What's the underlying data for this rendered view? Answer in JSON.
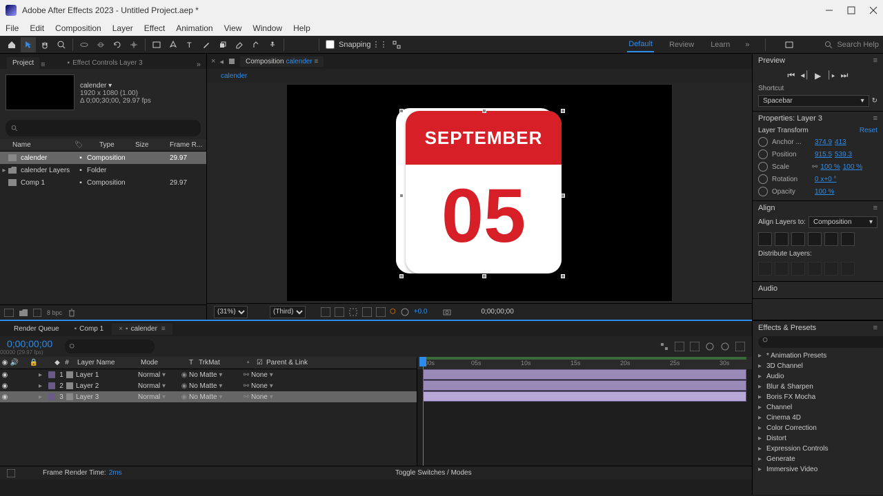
{
  "titlebar": {
    "title": "Adobe After Effects 2023 - Untitled Project.aep *"
  },
  "menu": [
    "File",
    "Edit",
    "Composition",
    "Layer",
    "Effect",
    "Animation",
    "View",
    "Window",
    "Help"
  ],
  "toolbar": {
    "snapping": "Snapping",
    "workspaces": [
      "Default",
      "Review",
      "Learn"
    ],
    "search_placeholder": "Search Help"
  },
  "project": {
    "tab_project": "Project",
    "tab_effect_controls": "Effect Controls Layer 3",
    "comp_name": "calender ▾",
    "comp_dims": "1920 x 1080 (1.00)",
    "comp_duration": "Δ 0;00;30;00, 29.97 fps",
    "col_name": "Name",
    "col_type": "Type",
    "col_size": "Size",
    "col_framerate": "Frame R...",
    "rows": [
      {
        "name": "calender",
        "type": "Composition",
        "fr": "29.97",
        "sel": true,
        "icon": "comp"
      },
      {
        "name": "calender Layers",
        "type": "Folder",
        "fr": "",
        "sel": false,
        "icon": "folder"
      },
      {
        "name": "Comp 1",
        "type": "Composition",
        "fr": "29.97",
        "sel": false,
        "icon": "comp"
      }
    ]
  },
  "comp": {
    "tab_label": "Composition",
    "tab_link": "calender",
    "breadcrumb": "calender",
    "month": "SEPTEMBER",
    "day": "05",
    "zoom": "(31%)",
    "res": "(Third)",
    "exposure": "+0.0",
    "timecode": "0;00;00;00"
  },
  "preview": {
    "header": "Preview",
    "shortcut_label": "Shortcut",
    "shortcut_value": "Spacebar"
  },
  "properties": {
    "header": "Properties: Layer 3",
    "transform_label": "Layer Transform",
    "reset": "Reset",
    "anchor_label": "Anchor ...",
    "anchor_x": "374.9",
    "anchor_y": "413",
    "position_label": "Position",
    "position_x": "915.5",
    "position_y": "539.3",
    "scale_label": "Scale",
    "scale_x": "100 %",
    "scale_y": "100 %",
    "rotation_label": "Rotation",
    "rotation_v": "0 x+0 °",
    "opacity_label": "Opacity",
    "opacity_v": "100 %"
  },
  "align": {
    "header": "Align",
    "layers_to_label": "Align Layers to:",
    "layers_to_value": "Composition",
    "distribute": "Distribute Layers:"
  },
  "audio": {
    "header": "Audio"
  },
  "effects": {
    "header": "Effects & Presets",
    "items": [
      "* Animation Presets",
      "3D Channel",
      "Audio",
      "Blur & Sharpen",
      "Boris FX Mocha",
      "Channel",
      "Cinema 4D",
      "Color Correction",
      "Distort",
      "Expression Controls",
      "Generate",
      "Immersive Video"
    ]
  },
  "timeline": {
    "tab_render": "Render Queue",
    "tab_comp1": "Comp 1",
    "tab_calender": "calender",
    "timecode": "0;00;00;00",
    "timecode_sub": "00000 (29.97 fps)",
    "col_layername": "Layer Name",
    "col_mode": "Mode",
    "col_trkmat": "TrkMat",
    "col_parent": "Parent & Link",
    "layers": [
      {
        "n": "1",
        "name": "Layer 1",
        "mode": "Normal",
        "mat": "No Matte",
        "parent": "None",
        "sel": false
      },
      {
        "n": "2",
        "name": "Layer 2",
        "mode": "Normal",
        "mat": "No Matte",
        "parent": "None",
        "sel": false
      },
      {
        "n": "3",
        "name": "Layer 3",
        "mode": "Normal",
        "mat": "No Matte",
        "parent": "None",
        "sel": true
      }
    ],
    "ticks": [
      ":00s",
      "05s",
      "10s",
      "15s",
      "20s",
      "25s",
      "30s"
    ],
    "footer_label": "Frame Render Time:",
    "footer_value": "2ms",
    "footer_toggle": "Toggle Switches / Modes",
    "bpc": "8 bpc"
  }
}
